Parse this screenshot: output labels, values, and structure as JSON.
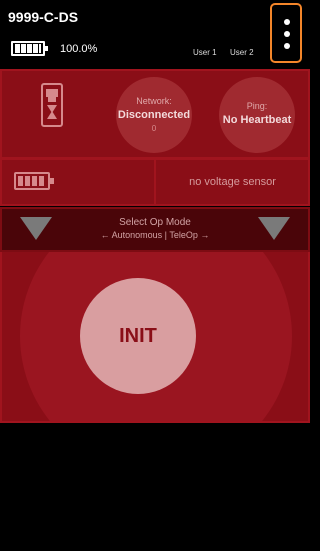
{
  "app": {
    "title": "9999-C-DS"
  },
  "status_bar": {
    "battery_percent": "100.0%",
    "battery_level": 1.0,
    "users": [
      "User 1",
      "User 2"
    ]
  },
  "status_panel": {
    "network": {
      "label": "Network:",
      "value": "Disconnected",
      "sub": "0"
    },
    "ping": {
      "label": "Ping:",
      "value": "No Heartbeat"
    }
  },
  "robot": {
    "battery_level": 1.0,
    "voltage_text": "no voltage sensor"
  },
  "opmode": {
    "title": "Select Op Mode",
    "subtitle": "← Autonomous | TeleOp →"
  },
  "init_button": {
    "label": "INIT"
  },
  "colors": {
    "panel_red": "#8a0e17",
    "highlight_orange": "#f4862a",
    "init_button": "#d99ea0"
  }
}
